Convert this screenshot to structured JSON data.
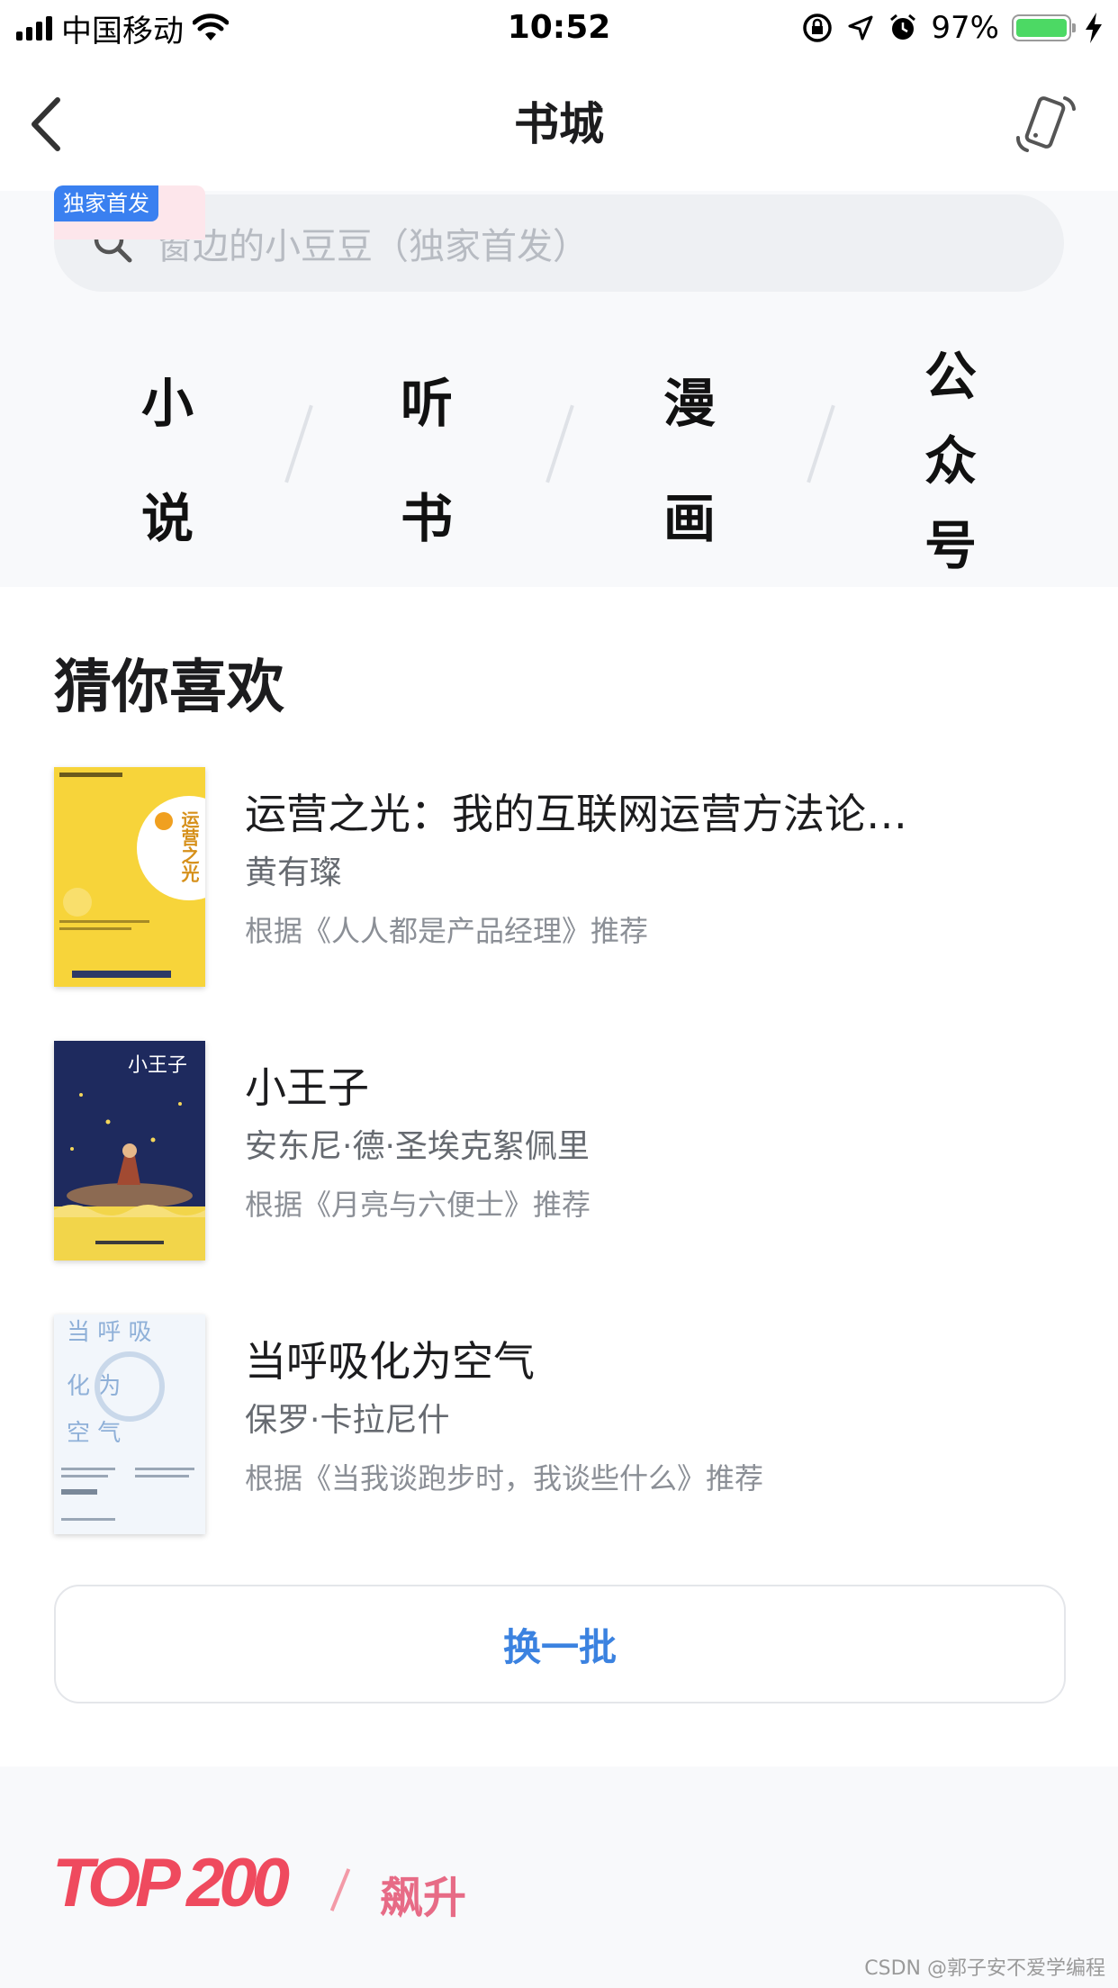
{
  "status_bar": {
    "carrier": "中国移动",
    "time": "10:52",
    "battery": "97%",
    "battery_level": 0.97
  },
  "nav": {
    "title": "书城"
  },
  "search": {
    "placeholder": "窗边的小豆豆（独家首发）"
  },
  "categories": [
    {
      "chars": [
        "小",
        "说"
      ]
    },
    {
      "chars": [
        "听",
        "书"
      ]
    },
    {
      "chars": [
        "漫",
        "画"
      ]
    },
    {
      "chars": [
        "公",
        "众",
        "号"
      ]
    }
  ],
  "recommend": {
    "title": "猜你喜欢",
    "books": [
      {
        "title": "运营之光：我的互联网运营方法论…",
        "author": "黄有璨",
        "reason": "根据《人人都是产品经理》推荐",
        "cover_title": "运营之光",
        "cover_color": "#f7d43a"
      },
      {
        "title": "小王子",
        "author": "安东尼·德·圣埃克絮佩里",
        "reason": "根据《月亮与六便士》推荐",
        "cover_title": "小王子",
        "cover_color": "#1e2a5e"
      },
      {
        "title": "当呼吸化为空气",
        "author": "保罗·卡拉尼什",
        "reason": "根据《当我谈跑步时，我谈些什么》推荐",
        "cover_title": "当呼吸化为空气",
        "cover_color": "#f2f6fb"
      }
    ],
    "refresh_label": "换一批"
  },
  "top200": {
    "logo": "TOP 200",
    "subtitle": "飙升",
    "tag": "独家首发"
  },
  "watermark": "CSDN @郭子安不爱学编程",
  "colors": {
    "accent_blue": "#3b82e0",
    "top_red": "#ef4a5e",
    "top_pink": "#e76b86"
  }
}
